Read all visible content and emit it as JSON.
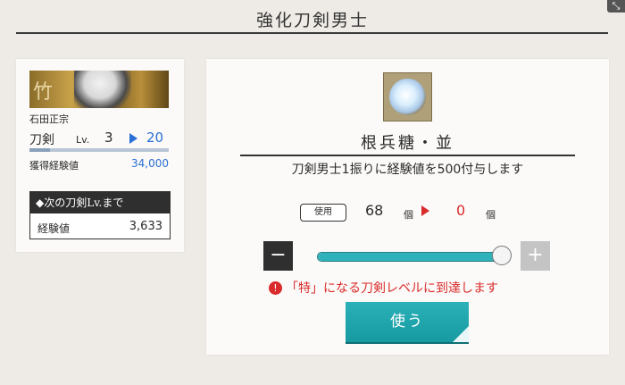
{
  "header": {
    "title": "強化刀剣男士"
  },
  "character": {
    "name": "石田正宗",
    "banner_glyph": "竹",
    "type": "刀剣",
    "lv_label": "Lv.",
    "level_current": "3",
    "level_next": "20",
    "exp_label": "獲得経験値",
    "exp_value": "34,000",
    "level_progress": 0.15
  },
  "next_level": {
    "title": "◆次の刀剣Lv.まで",
    "label": "経験値",
    "value": "3,633"
  },
  "item": {
    "name": "根兵糖・並",
    "description": "刀剣男士1振りに経験値を500付与します",
    "use_label": "使用",
    "count_have": "68",
    "unit": "個",
    "count_use": "0",
    "slider_value": 1.0,
    "minus": "−",
    "plus": "+",
    "warning_icon": "!",
    "warning": "「特」になる刀剣レベルに到達します",
    "use_button": "使う"
  },
  "colors": {
    "accent_teal": "#1fa5ac",
    "level_blue": "#2a6fd6",
    "warning_red": "#d92b2b"
  }
}
